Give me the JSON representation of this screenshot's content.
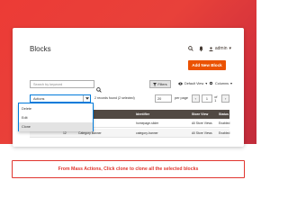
{
  "page": {
    "title": "Blocks",
    "add_button": "Add New Block",
    "user_name": "admin"
  },
  "toolbar": {
    "search_placeholder": "Search by keyword",
    "filters_label": "Filters",
    "view_label": "Default View",
    "columns_label": "Columns"
  },
  "grid": {
    "actions_label": "Actions",
    "records_text": "2 records found (2 selected)",
    "per_page_value": "20",
    "per_page_label": "per page",
    "page_current": "1",
    "page_total": "of 1"
  },
  "mass_actions": {
    "options": [
      "Delete",
      "Edit",
      "Clone"
    ],
    "selected": "Clone"
  },
  "table": {
    "columns": [
      "",
      "ID",
      "Title",
      "Identifier",
      "Store View",
      "Status"
    ],
    "rows": [
      {
        "id": "",
        "title": "",
        "identifier": "homepage-slider",
        "store_view": "All Store Views",
        "status": "Enabled"
      },
      {
        "id": "12",
        "title": "Category Banner",
        "identifier": "category-banner",
        "store_view": "All Store Views",
        "status": "Enabled"
      }
    ]
  },
  "caption": "From Mass Actions, Click clone to clone all the selected blocks",
  "colors": {
    "accent": "#eb5202",
    "brand_red": "#e0362f",
    "table_header": "#514943",
    "focus_blue": "#007bdb"
  }
}
